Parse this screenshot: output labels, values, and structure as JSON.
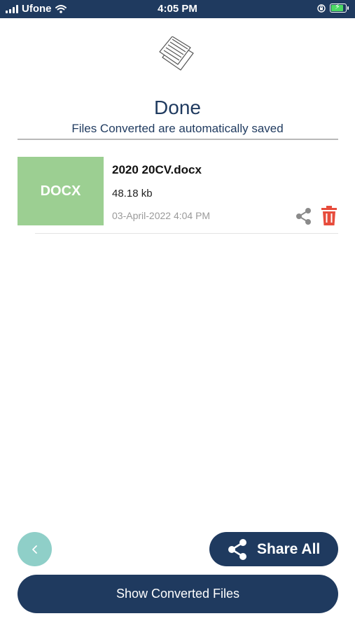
{
  "status_bar": {
    "carrier": "Ufone",
    "time": "4:05 PM",
    "icons": [
      "signal-icon",
      "wifi-icon",
      "orientation-lock-icon",
      "battery-charging-icon"
    ]
  },
  "header": {
    "illustration_icon": "documents-icon",
    "title": "Done",
    "subtitle": "Files Converted are automatically saved"
  },
  "files": [
    {
      "type_label": "DOCX",
      "name": "2020 20CV.docx",
      "size": "48.18 kb",
      "date": "03-April-2022 4:04 PM",
      "actions": [
        "share-icon",
        "trash-icon"
      ]
    }
  ],
  "footer": {
    "back_icon": "chevron-left-icon",
    "share_all_label": "Share All",
    "show_files_label": "Show Converted Files"
  },
  "colors": {
    "primary": "#1f3a5f",
    "thumb_docx": "#9ccf92",
    "back_button": "#8fcfc8",
    "delete": "#e74c3c",
    "share_icon": "#8a8a8a"
  }
}
